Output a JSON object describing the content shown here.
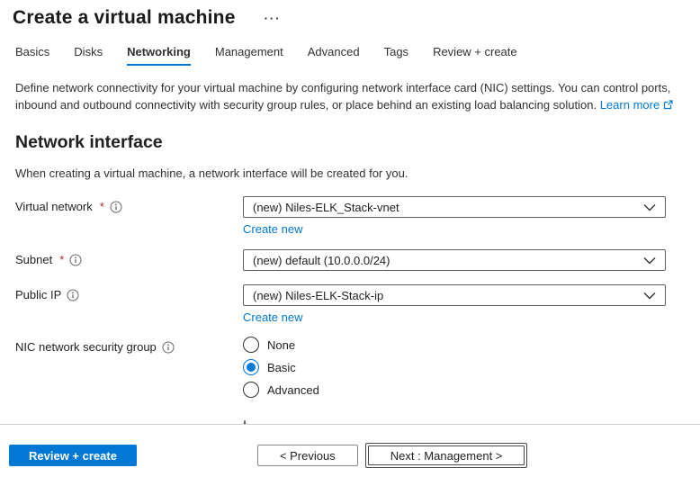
{
  "header": {
    "title": "Create a virtual machine",
    "more_options": "···"
  },
  "tabs": [
    {
      "label": "Basics"
    },
    {
      "label": "Disks"
    },
    {
      "label": "Networking"
    },
    {
      "label": "Management"
    },
    {
      "label": "Advanced"
    },
    {
      "label": "Tags"
    },
    {
      "label": "Review + create"
    }
  ],
  "intro": {
    "text": "Define network connectivity for your virtual machine by configuring network interface card (NIC) settings. You can control ports, inbound and outbound connectivity with security group rules, or place behind an existing load balancing solution. ",
    "learn_more_label": "Learn more"
  },
  "section": {
    "heading": "Network interface",
    "description": "When creating a virtual machine, a network interface will be created for you."
  },
  "fields": {
    "virtual_network": {
      "label": "Virtual network",
      "required_marker": "*",
      "value": "(new) Niles-ELK_Stack-vnet",
      "create_new_label": "Create new"
    },
    "subnet": {
      "label": "Subnet",
      "required_marker": "*",
      "value": "(new) default (10.0.0.0/24)"
    },
    "public_ip": {
      "label": "Public IP",
      "value": "(new) Niles-ELK-Stack-ip",
      "create_new_label": "Create new"
    },
    "nic_nsg": {
      "label": "NIC network security group",
      "options": [
        {
          "label": "None",
          "selected": false
        },
        {
          "label": "Basic",
          "selected": true
        },
        {
          "label": "Advanced",
          "selected": false
        }
      ]
    }
  },
  "footer": {
    "review_create_label": "Review + create",
    "previous_label": "< Previous",
    "next_label": "Next : Management >"
  },
  "colors": {
    "accent": "#0078d4",
    "required_asterisk": "#a4262c",
    "text": "#201f1e"
  }
}
